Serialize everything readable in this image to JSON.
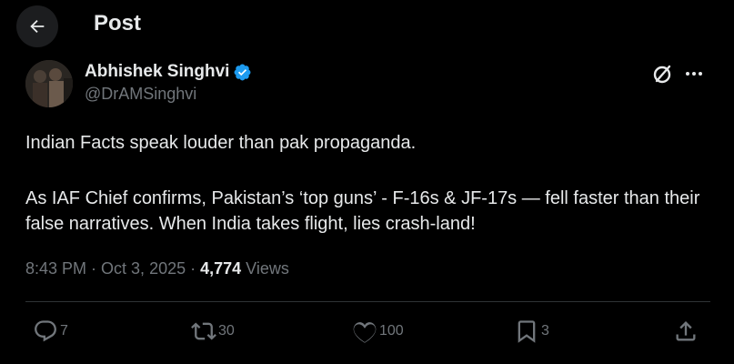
{
  "header": {
    "title": "Post"
  },
  "author": {
    "display_name": "Abhishek Singhvi",
    "handle": "@DrAMSinghvi",
    "verified": true,
    "verified_color": "#1d9bf0"
  },
  "tweet": {
    "paragraph_1": "Indian Facts speak louder than pak propaganda.",
    "paragraph_2": "As IAF Chief confirms, Pakistan’s ‘top guns’ - F-16s & JF-17s — fell faster than their false narratives. When India takes flight, lies crash-land!"
  },
  "meta": {
    "time": "8:43 PM",
    "separator_1": " · ",
    "date": "Oct 3, 2025",
    "separator_2": " · ",
    "views_count": "4,774",
    "views_label": " Views"
  },
  "actions": {
    "replies": "7",
    "reposts": "30",
    "likes": "100",
    "bookmarks": "3"
  },
  "icons": {
    "back": "arrow-left-icon",
    "grok": "grok-icon",
    "more": "more-icon",
    "reply": "reply-icon",
    "repost": "repost-icon",
    "like": "heart-icon",
    "bookmark": "bookmark-icon",
    "share": "share-icon"
  }
}
